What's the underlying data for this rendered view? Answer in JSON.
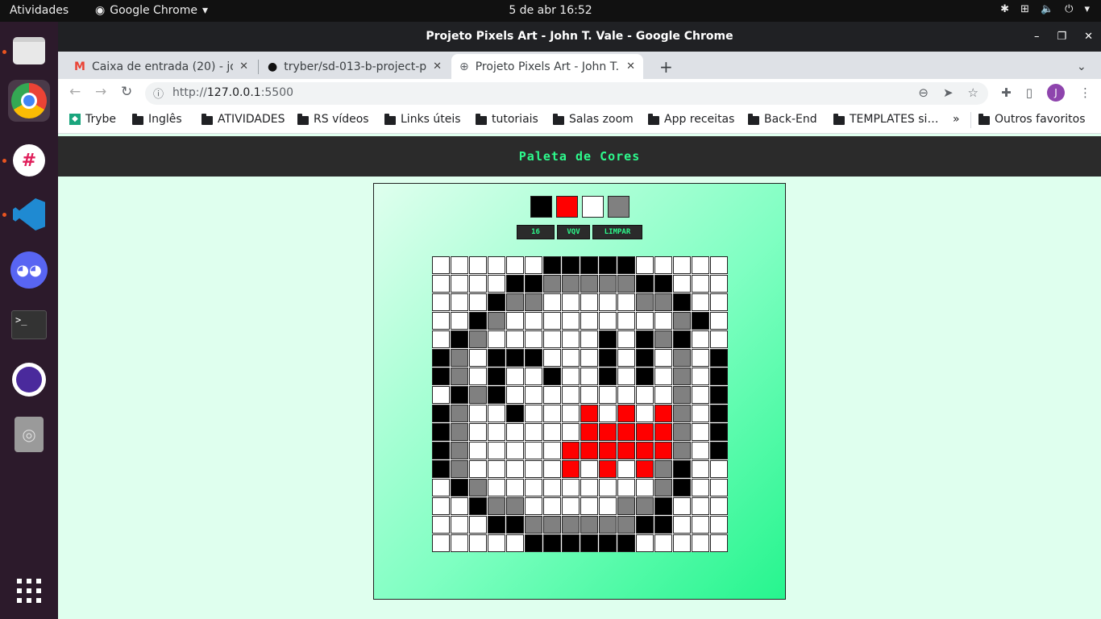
{
  "os": {
    "activities_label": "Atividades",
    "app_name": "Google Chrome",
    "clock": "5 de abr  16:52"
  },
  "window": {
    "title": "Projeto Pixels Art - John T. Vale - Google Chrome"
  },
  "tabs": [
    {
      "label": "Caixa de entrada (20) - john",
      "icon": "gmail-icon"
    },
    {
      "label": "tryber/sd-013-b-project-pi",
      "icon": "github-icon"
    },
    {
      "label": "Projeto Pixels Art - John T.",
      "icon": "globe-icon",
      "active": true
    }
  ],
  "omnibox": {
    "url_prefix": "http://",
    "url_host": "127.0.0.1",
    "url_port": ":5500"
  },
  "profile_initial": "J",
  "bookmarks": [
    "Trybe",
    "Inglês",
    "ATIVIDADES",
    "RS vídeos",
    "Links úteis",
    "tutoriais",
    "Salas zoom",
    "App receitas",
    "Back-End",
    "TEMPLATES si…"
  ],
  "bookmarks_overflow": "»",
  "other_bookmarks": "Outros favoritos",
  "page": {
    "title": "Paleta de Cores",
    "palette": [
      "#000000",
      "#ff0000",
      "#ffffff",
      "#808080"
    ],
    "board_size_value": "16",
    "vqv_label": "VQV",
    "clear_label": "LIMPAR",
    "pixel_colors": {
      "K": "#000000",
      "G": "#808080",
      "R": "#ff0000",
      "W": "#ffffff"
    },
    "grid": [
      "WWWWWWKKKKKWWWWW",
      "WWWWKKGGGGGKKWWW",
      "WWWKGGWWWWWGGKWW",
      "WWKGWWWWWWWWWGKW",
      "WKGWWWWWWKWKGKWW",
      "KGWKKKWWWKWKWGWK",
      "KGWKWWKWWKWKWGWK",
      "WKGKWWWWWWWWWGWK",
      "KGWWKWWWRWRWRGWK",
      "KGWWWWWWRRRRRGWK",
      "KGWWWWWRRRRRRGWK",
      "KGWWWWWRWRWRGKWW",
      "WKGWWWWWWWWWGKWW",
      "WWKGGWWWWWGGKWWW",
      "WWWKKGGGGGGKKWWW",
      "WWWWWKKKKKKWWWWW"
    ]
  }
}
